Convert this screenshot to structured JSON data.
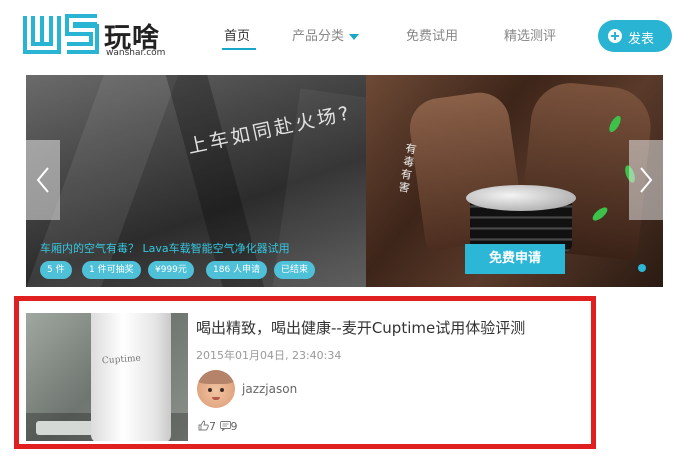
{
  "header": {
    "logo_letters": "WS",
    "logo_name": "玩啥",
    "logo_domain": "wanshar.com",
    "nav": [
      {
        "label": "首页",
        "active": true
      },
      {
        "label": "产品分类",
        "has_dropdown": true
      },
      {
        "label": "免费试用"
      },
      {
        "label": "精选测评"
      }
    ],
    "post_button": "发表",
    "accent_color": "#29b4d3"
  },
  "banner": {
    "slogan": "上车如同赴火场?",
    "vertical_text": "有毒有害",
    "caption": "车厢内的空气有毒？ Lava车载智能空气净化器试用",
    "tags": [
      "5 件",
      "1 件可抽奖",
      "¥999元",
      "186 人申请",
      "已结束"
    ],
    "apply_button": "免费申请",
    "prev_icon": "chevron-left-icon",
    "next_icon": "chevron-right-icon"
  },
  "article": {
    "title": "喝出精致，喝出健康--麦开Cuptime试用体验评测",
    "date": "2015年01月04日, 23:40:34",
    "author": "jazzjason",
    "thumb_label": "Cuptime",
    "likes": "7",
    "comments": "9",
    "highlight_color": "#e02020"
  }
}
